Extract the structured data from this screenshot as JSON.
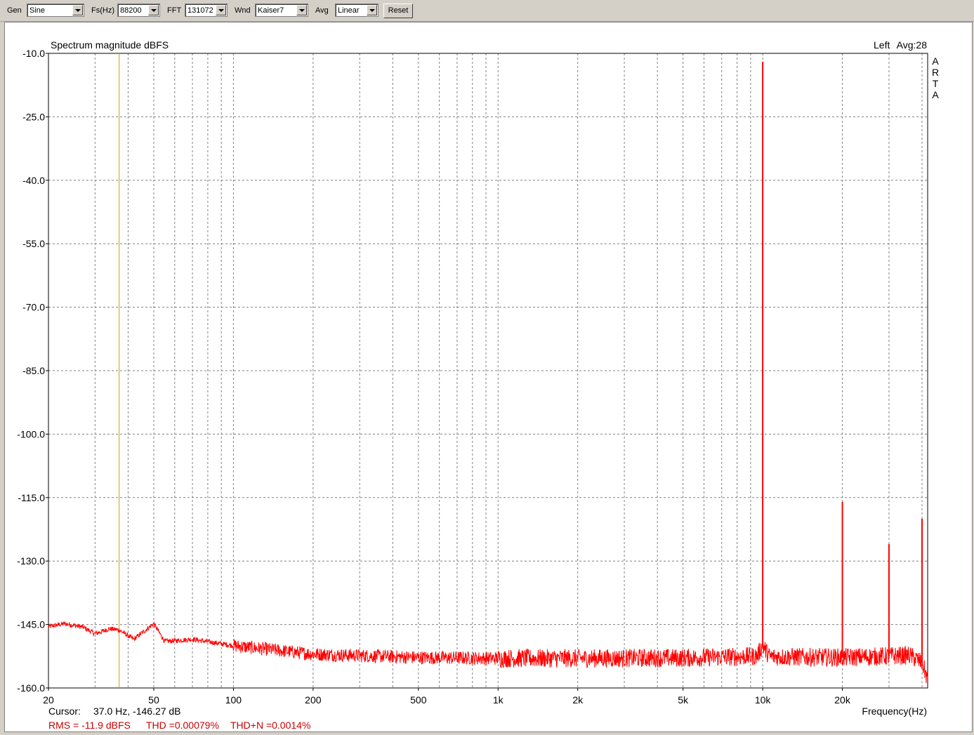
{
  "toolbar": {
    "gen": {
      "label": "Gen",
      "value": "Sine"
    },
    "fs": {
      "label": "Fs(Hz)",
      "value": "88200"
    },
    "fft": {
      "label": "FFT",
      "value": "131072"
    },
    "wnd": {
      "label": "Wnd",
      "value": "Kaiser7"
    },
    "avg": {
      "label": "Avg",
      "value": "Linear"
    },
    "reset_label": "Reset"
  },
  "plot": {
    "title": "Spectrum magnitude dBFS",
    "channel": "Left",
    "avg": "Avg:28",
    "watermark": [
      "A",
      "R",
      "T",
      "A"
    ],
    "xlabel": "Frequency(Hz)",
    "cursor_label": "Cursor:",
    "cursor_value": "37.0 Hz, -146.27 dB",
    "stats": {
      "rms": "RMS =  -11.9 dBFS",
      "thd": "THD =0.00079%",
      "thdn": "THD+N =0.0014%"
    }
  },
  "chart_data": {
    "type": "line",
    "title": "Spectrum magnitude dBFS",
    "xlabel": "Frequency(Hz)",
    "ylabel": "",
    "xscale": "log",
    "xlim": [
      20,
      42000
    ],
    "ylim": [
      -160,
      -10
    ],
    "grid": true,
    "y_ticks": [
      -10,
      -25,
      -40,
      -55,
      -70,
      -85,
      -100,
      -115,
      -130,
      -145,
      -160
    ],
    "y_tick_labels": [
      "-10.0",
      "-25.0",
      "-40.0",
      "-55.0",
      "-70.0",
      "-85.0",
      "-100.0",
      "-115.0",
      "-130.0",
      "-145.0",
      "-160.0"
    ],
    "x_tick_labels": [
      {
        "f": 20,
        "label": "20"
      },
      {
        "f": 50,
        "label": "50"
      },
      {
        "f": 100,
        "label": "100"
      },
      {
        "f": 200,
        "label": "200"
      },
      {
        "f": 500,
        "label": "500"
      },
      {
        "f": 1000,
        "label": "1k"
      },
      {
        "f": 2000,
        "label": "2k"
      },
      {
        "f": 5000,
        "label": "5k"
      },
      {
        "f": 10000,
        "label": "10k"
      },
      {
        "f": 20000,
        "label": "20k"
      }
    ],
    "grid_freqs": [
      20,
      30,
      40,
      50,
      60,
      70,
      80,
      90,
      100,
      200,
      300,
      400,
      500,
      600,
      700,
      800,
      900,
      1000,
      2000,
      3000,
      4000,
      5000,
      6000,
      7000,
      8000,
      9000,
      10000,
      20000,
      30000,
      40000
    ],
    "cursor_freq": 37.0,
    "noise_floor": [
      [
        20,
        -145.5
      ],
      [
        23,
        -144.8
      ],
      [
        27,
        -145.6
      ],
      [
        30,
        -147.2
      ],
      [
        34,
        -146.0
      ],
      [
        37,
        -146.3
      ],
      [
        42,
        -148.5
      ],
      [
        50,
        -144.8
      ],
      [
        55,
        -149.0
      ],
      [
        70,
        -148.5
      ],
      [
        100,
        -150.0
      ],
      [
        200,
        -152.0
      ],
      [
        500,
        -152.8
      ],
      [
        1000,
        -153.0
      ],
      [
        2000,
        -153.0
      ],
      [
        5000,
        -152.9
      ],
      [
        9500,
        -152.5
      ],
      [
        10000,
        -150.0
      ],
      [
        10600,
        -152.6
      ],
      [
        20000,
        -152.8
      ],
      [
        36000,
        -152.3
      ],
      [
        40000,
        -154.0
      ],
      [
        42000,
        -158.0
      ]
    ],
    "series": [
      {
        "peaks": [
          {
            "x": 10000,
            "y": -12.0
          },
          {
            "x": 20000,
            "y": -116.0
          },
          {
            "x": 30000,
            "y": -126.0
          },
          {
            "x": 40000,
            "y": -120.0
          }
        ]
      }
    ],
    "colors": {
      "trace": "#ff0000",
      "cursor": "#c8a000",
      "grid": "#808080",
      "stats": "#cc0000"
    }
  }
}
